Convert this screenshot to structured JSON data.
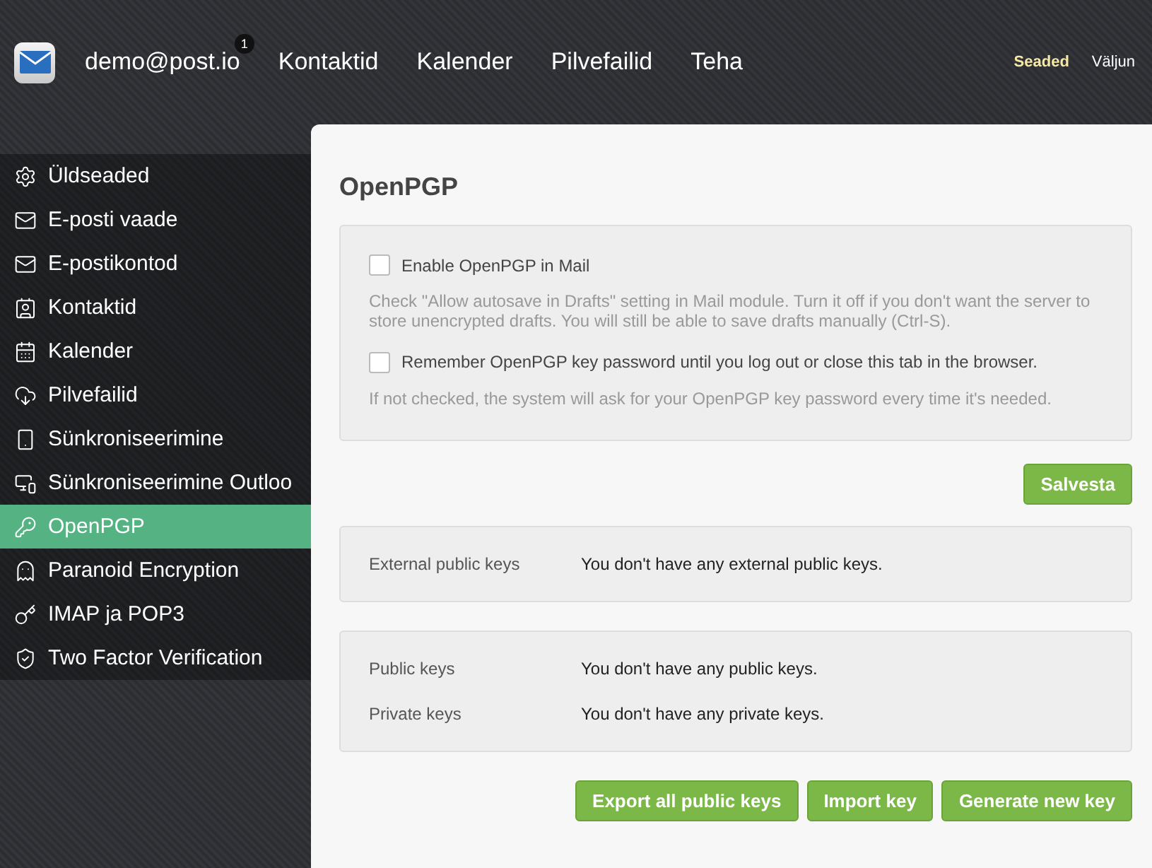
{
  "header": {
    "account": "demo@post.io",
    "badge": "1",
    "nav": [
      {
        "label": "Kontaktid",
        "selected": false
      },
      {
        "label": "Kalender",
        "selected": false
      },
      {
        "label": "Pilvefailid",
        "selected": false
      },
      {
        "label": "Teha",
        "selected": false
      }
    ],
    "settings": {
      "label": "Seaded",
      "selected": true
    },
    "logout": "Väljun"
  },
  "sidebar": {
    "items": [
      {
        "label": "Üldseaded",
        "selected": false
      },
      {
        "label": "E-posti vaade",
        "selected": false
      },
      {
        "label": "E-postikontod",
        "selected": false
      },
      {
        "label": "Kontaktid",
        "selected": false
      },
      {
        "label": "Kalender",
        "selected": false
      },
      {
        "label": "Pilvefailid",
        "selected": false
      },
      {
        "label": "Sünkroniseerimine",
        "selected": false
      },
      {
        "label": "Sünkroniseerimine Outloo",
        "selected": false
      },
      {
        "label": "OpenPGP",
        "selected": true
      },
      {
        "label": "Paranoid Encryption",
        "selected": false
      },
      {
        "label": "IMAP ja POP3",
        "selected": false
      },
      {
        "label": "Two Factor Verification",
        "selected": false
      }
    ]
  },
  "content": {
    "title": "OpenPGP",
    "options": [
      {
        "label": "Enable OpenPGP in Mail",
        "checked": false,
        "hint": "Check \"Allow autosave in Drafts\" setting in Mail module. Turn it off if you don't want the server to store unencrypted drafts. You will still be able to save drafts manually (Ctrl-S)."
      },
      {
        "label": "Remember OpenPGP key password until you log out or close this tab in the browser.",
        "checked": false,
        "hint": "If not checked, the system will ask for your OpenPGP key password every time it's needed."
      }
    ],
    "save_button": "Salvesta",
    "key_groups": [
      [
        {
          "label": "External public keys",
          "value": "You don't have any external public keys."
        }
      ],
      [
        {
          "label": "Public keys",
          "value": "You don't have any public keys."
        },
        {
          "label": "Private keys",
          "value": "You don't have any private keys."
        }
      ]
    ],
    "buttons": [
      "Export all public keys",
      "Import key",
      "Generate new key"
    ]
  }
}
